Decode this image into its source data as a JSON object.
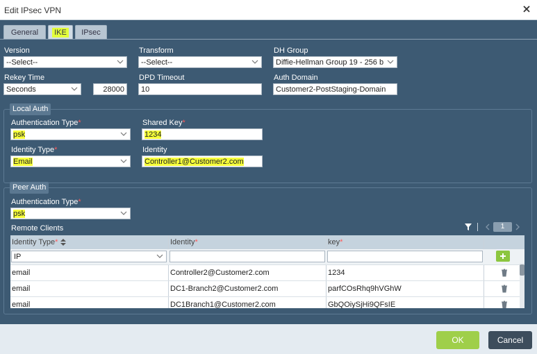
{
  "dialog": {
    "title": "Edit IPsec VPN"
  },
  "tabs": [
    {
      "label": "General"
    },
    {
      "label": "IKE"
    },
    {
      "label": "IPsec"
    }
  ],
  "ike": {
    "version": {
      "label": "Version",
      "value": "--Select--"
    },
    "transform": {
      "label": "Transform",
      "value": "--Select--"
    },
    "dh_group": {
      "label": "DH Group",
      "value": "Diffie-Hellman Group 19 - 256 b"
    },
    "rekey_time": {
      "label": "Rekey Time",
      "unit": "Seconds",
      "value": "28000"
    },
    "dpd_timeout": {
      "label": "DPD Timeout",
      "value": "10"
    },
    "auth_domain": {
      "label": "Auth Domain",
      "value": "Customer2-PostStaging-Domain"
    }
  },
  "local_auth": {
    "title": "Local Auth",
    "auth_type": {
      "label": "Authentication Type",
      "value": "psk"
    },
    "shared_key": {
      "label": "Shared Key",
      "value": "1234"
    },
    "identity_type": {
      "label": "Identity Type",
      "value": "Email"
    },
    "identity": {
      "label": "Identity",
      "value": "Controller1@Customer2.com"
    }
  },
  "peer_auth": {
    "title": "Peer Auth",
    "auth_type": {
      "label": "Authentication Type",
      "value": "psk"
    },
    "remote_clients": {
      "title": "Remote Clients",
      "page": "1",
      "columns": [
        "Identity Type",
        "Identity",
        "key"
      ],
      "filter_identity_type": "IP",
      "rows": [
        {
          "identity_type": "email",
          "identity": "Controller2@Customer2.com",
          "key": "1234"
        },
        {
          "identity_type": "email",
          "identity": "DC1-Branch2@Customer2.com",
          "key": "parfCOsRhq9hVGhW"
        },
        {
          "identity_type": "email",
          "identity": "DC1Branch1@Customer2.com",
          "key": "GbQOiySjHi9QFsIE"
        }
      ]
    }
  },
  "footer": {
    "ok_label": "OK",
    "cancel_label": "Cancel"
  },
  "colors": {
    "panel": "#3d5a73",
    "highlight": "#f6ff3a",
    "ok": "#9fcf4a",
    "cancel": "#3d4d5c",
    "required": "#ff5a5a"
  }
}
